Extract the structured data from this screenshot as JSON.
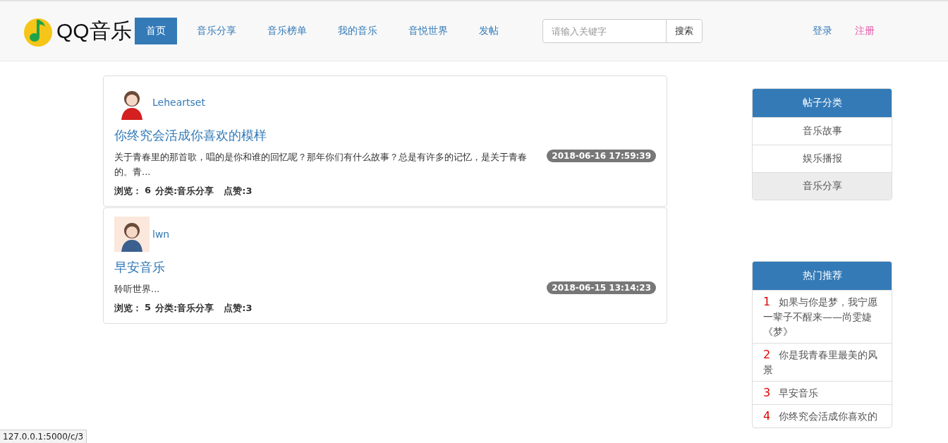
{
  "navbar": {
    "brand": "QQ音乐",
    "nav_items": [
      {
        "label": "首页",
        "selected": true
      },
      {
        "label": "音乐分享",
        "selected": false
      },
      {
        "label": "音乐榜单",
        "selected": false
      },
      {
        "label": "我的音乐",
        "selected": false
      },
      {
        "label": "音悦世界",
        "selected": false
      },
      {
        "label": "发帖",
        "selected": false
      }
    ],
    "search": {
      "placeholder": "请输入关键字",
      "button": "搜索"
    },
    "login": "登录",
    "register": "注册"
  },
  "posts": [
    {
      "author": "Leheartset",
      "title": "你终究会活成你喜欢的模样",
      "excerpt": "关于青春里的那首歌，唱的是你和谁的回忆呢？那年你们有什么故事？总是有许多的记忆，是关于青春的。青...",
      "time": "2018-06-16 17:59:39",
      "views_label": "浏览：",
      "views": "6",
      "category": "分类:音乐分享",
      "likes": "点赞:3"
    },
    {
      "author": "lwn",
      "title": "早安音乐",
      "excerpt": "聆听世界...",
      "time": "2018-06-15 13:14:23",
      "views_label": "浏览：",
      "views": "5",
      "category": "分类:音乐分享",
      "likes": "点赞:3"
    }
  ],
  "categories": {
    "title": "帖子分类",
    "items": [
      {
        "label": "音乐故事",
        "selected": false
      },
      {
        "label": "娱乐播报",
        "selected": false
      },
      {
        "label": "音乐分享",
        "selected": true
      }
    ]
  },
  "hot": {
    "title": "热门推荐",
    "items": [
      {
        "rank": "1",
        "title": "如果与你是梦，我宁愿一辈子不醒来——尚雯婕《梦》"
      },
      {
        "rank": "2",
        "title": "你是我青春里最美的风景"
      },
      {
        "rank": "3",
        "title": "早安音乐"
      },
      {
        "rank": "4",
        "title": "你终究会活成你喜欢的"
      }
    ]
  },
  "status_bar": "127.0.0.1:5000/c/3"
}
